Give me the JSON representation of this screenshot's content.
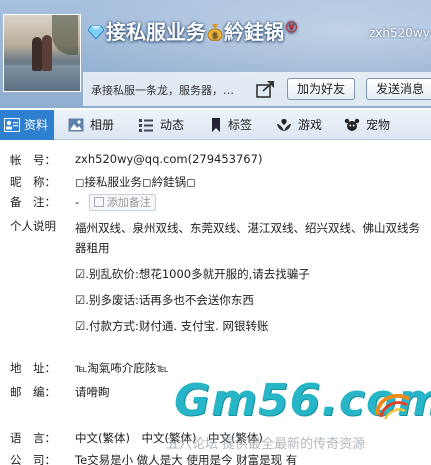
{
  "header": {
    "nickname": "接私服业务",
    "nickname_tail": "紟銈锅",
    "vip_badge": "Ⓥ",
    "account_id": "zxh520wy",
    "signature": "承接私服一条龙，服务器，…",
    "add_friend_label": "加为好友",
    "send_message_label": "发送消息"
  },
  "tabs": [
    {
      "label": "资料",
      "icon": "profile-card-icon",
      "active": true
    },
    {
      "label": "相册",
      "icon": "photo-album-icon",
      "active": false
    },
    {
      "label": "动态",
      "icon": "feed-icon",
      "active": false
    },
    {
      "label": "标签",
      "icon": "bookmark-icon",
      "active": false
    },
    {
      "label": "游戏",
      "icon": "game-icon",
      "active": false
    },
    {
      "label": "宠物",
      "icon": "pet-icon",
      "active": false
    }
  ],
  "profile": {
    "account_label": "帐　号：",
    "account_value": "zxh520wy@qq.com(279453767)",
    "nickname_label": "昵　称：",
    "nickname_value": "◻接私服业务◻紟銈锅◻",
    "note_label": "备　注：",
    "note_value": "-",
    "add_note_label": "添加备注",
    "description_label": "个人说明",
    "description_lines": [
      "福州双线、泉州双线、东莞双线、湛江双线、绍兴双线、佛山双线务器租用",
      "☑.别乱砍价:想花1000多就开服的,请去找骗子",
      "☑.别多废话:话再多也不会送你东西",
      "☑.付款方式:财付通. 支付宝. 网银转账"
    ],
    "address_label": "地　址：",
    "address_value": "℡淘氣咘介庇陔℡",
    "postcode_label": "邮　编：",
    "postcode_value": "请嗗眴",
    "language_label": "语　言：",
    "language_value": "中文(繁体)　中文(繁体)　中文(繁体)",
    "company_label": "公　司：",
    "company_value": "Te交易是小 做人是大 使用是今 财富是现 有"
  },
  "watermark": {
    "logo_text": "Gm56.com",
    "tagline": "五六论坛 提供最全最新的传奇资源"
  },
  "colors": {
    "tab_active": "#2f7fd1",
    "header_blue": "#9bb6d6",
    "watermark_teal": "#27b6c8"
  }
}
